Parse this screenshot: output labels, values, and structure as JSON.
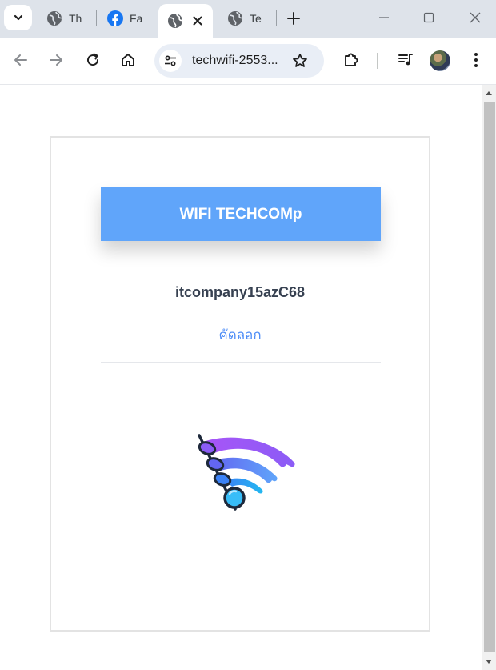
{
  "tabs": [
    {
      "title": "Th",
      "icon": "globe-icon"
    },
    {
      "title": "Fa",
      "icon": "facebook-icon"
    },
    {
      "title": "",
      "icon": "globe-icon",
      "active": true
    },
    {
      "title": "Te",
      "icon": "globe-icon"
    }
  ],
  "address_bar": {
    "url": "techwifi-2553..."
  },
  "page": {
    "banner_title": "WIFI TECHCOMp",
    "ssid": "itcompany15azC68",
    "copy_label": "คัดลอก"
  },
  "colors": {
    "banner": "#60a5fa",
    "link": "#4f8ef7",
    "ssid_text": "#374151"
  }
}
